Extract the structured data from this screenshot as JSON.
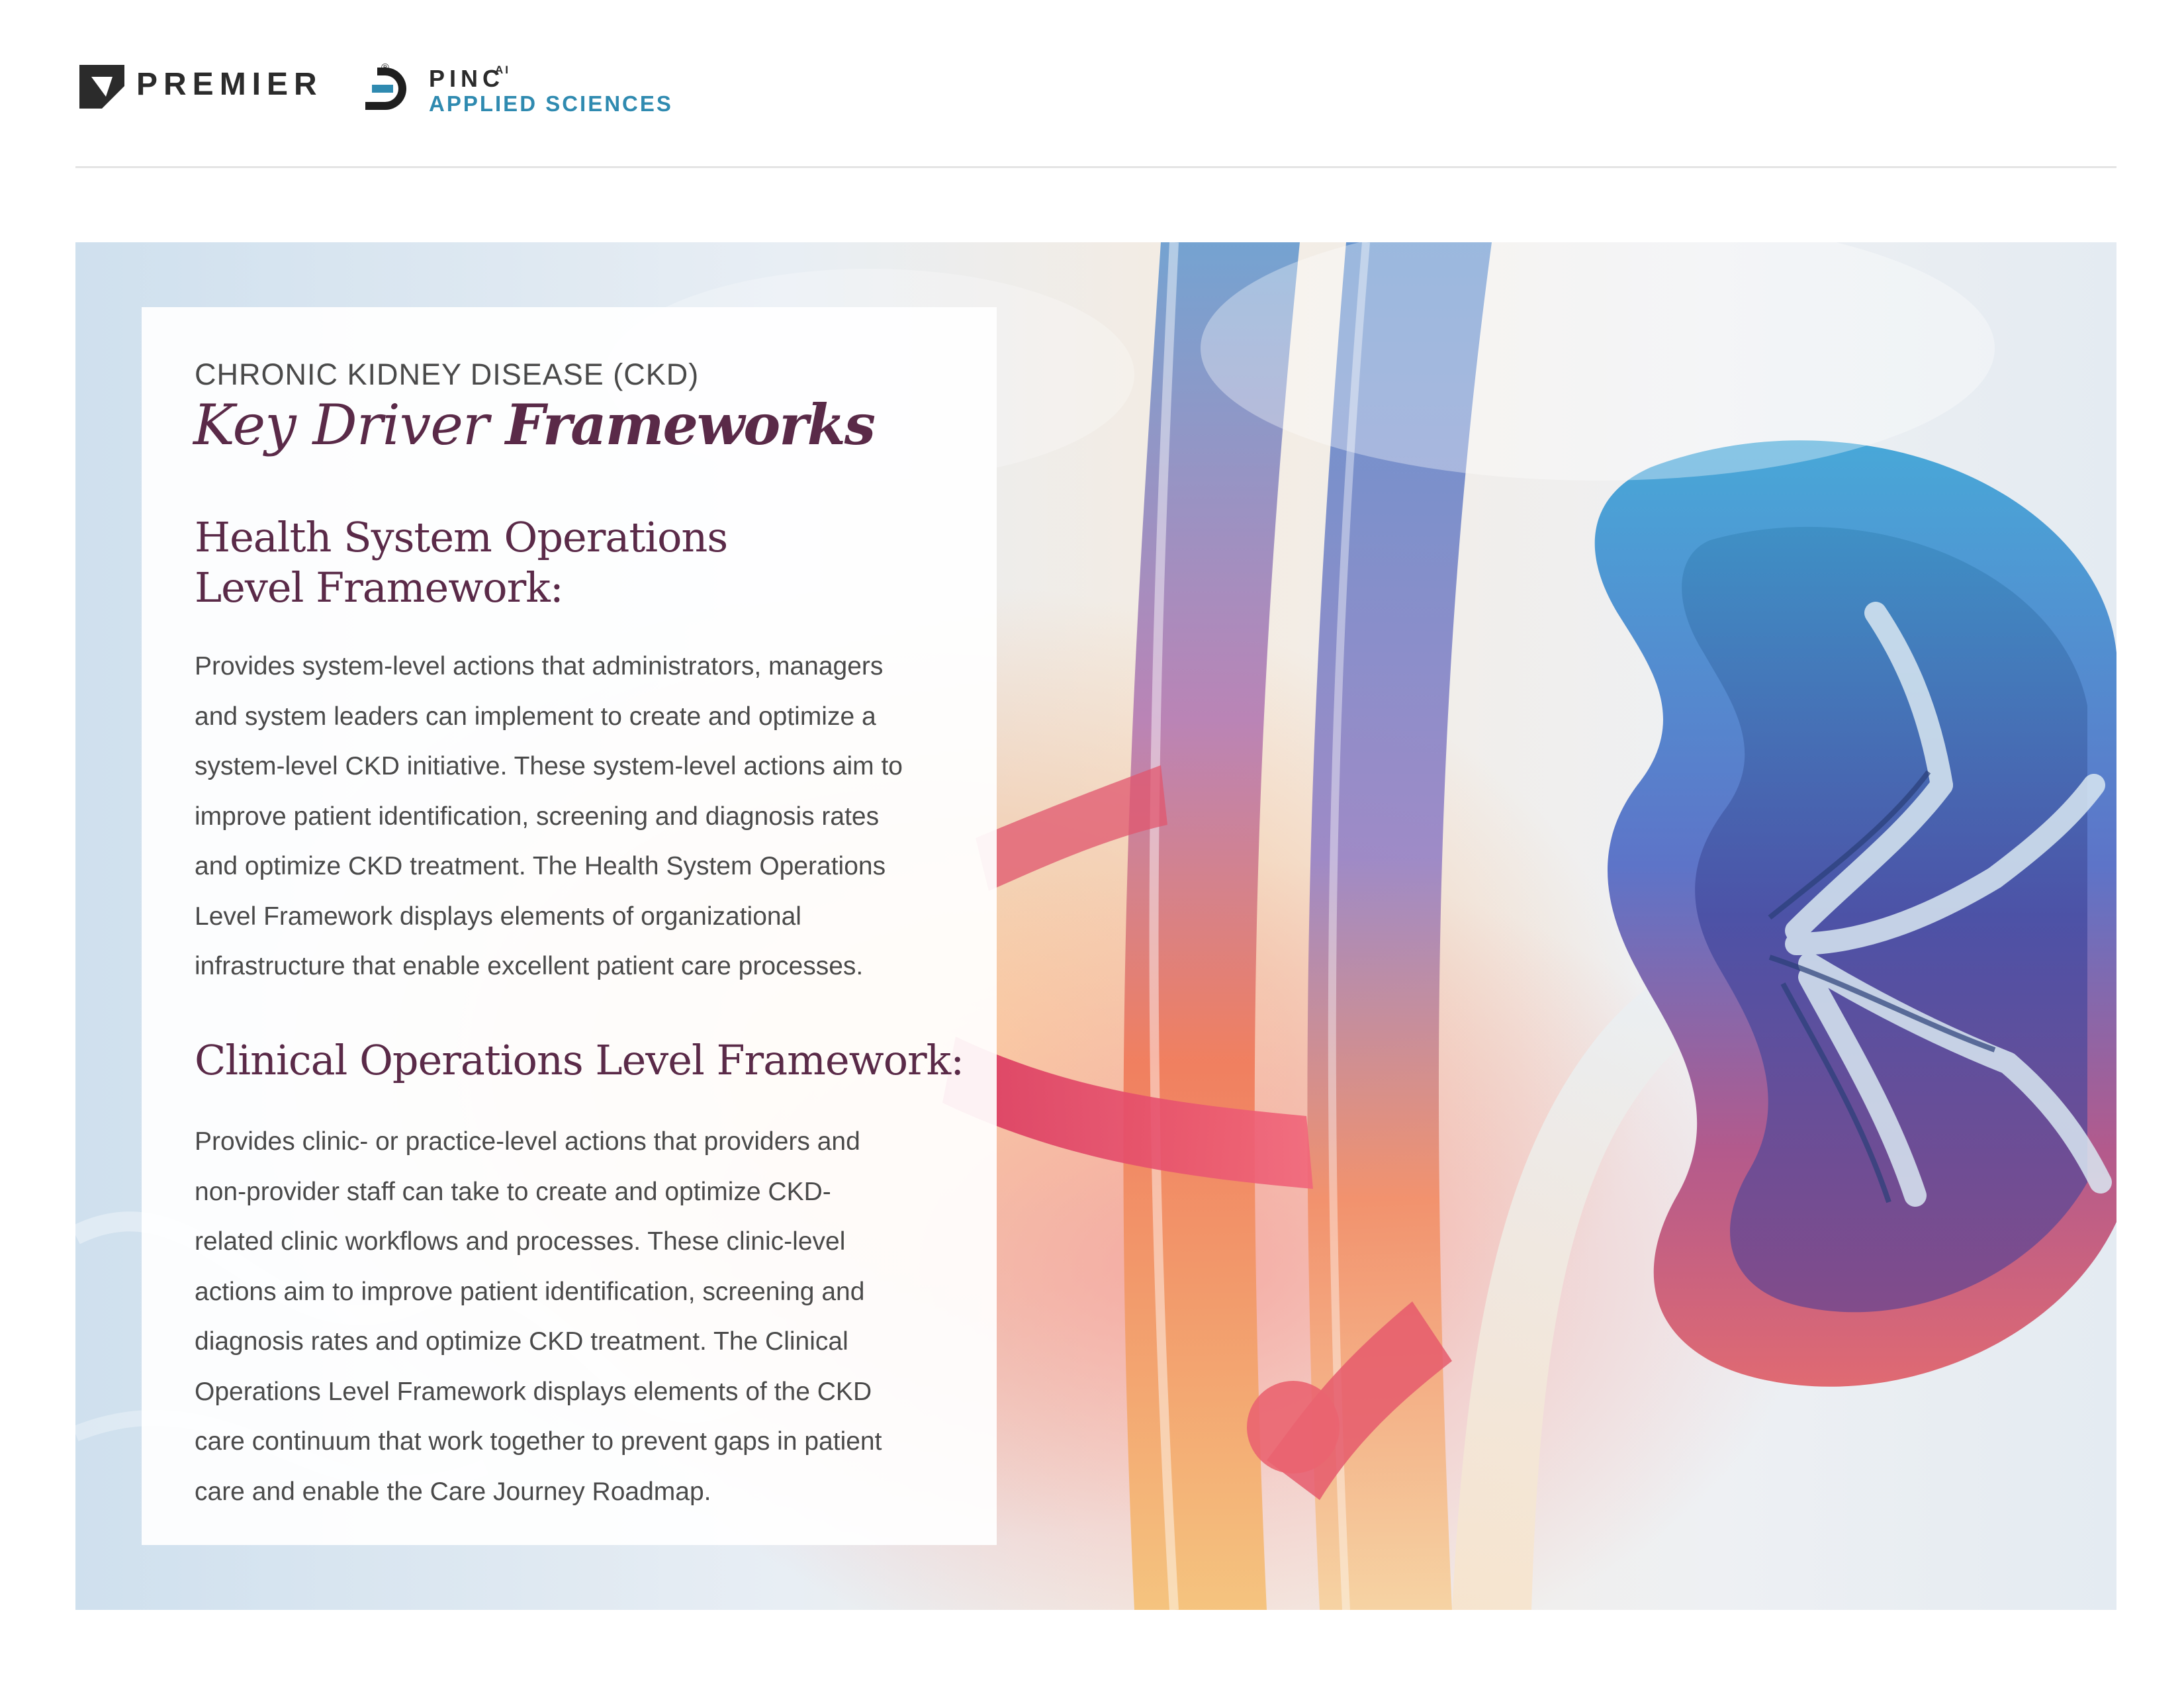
{
  "header": {
    "premier_logo_text": "PREMIER",
    "premier_logo_reg": "®",
    "pinc_logo_text": "PINC",
    "pinc_logo_superscript": "AI",
    "pinc_logo_subtitle": "APPLIED SCIENCES"
  },
  "card": {
    "eyebrow": "CHRONIC KIDNEY DISEASE (CKD)",
    "title_light": "Key Driver ",
    "title_bold": "Frameworks",
    "sections": [
      {
        "heading_lines": [
          "Health System Operations",
          "Level Framework:"
        ],
        "body_lines": [
          "Provides system-level actions that administrators, managers",
          "and system leaders can implement to create and optimize a",
          "system-level CKD initiative. These system-level actions aim to",
          "improve patient identification, screening and diagnosis rates",
          "and optimize CKD treatment. The Health System Operations",
          "Level Framework displays elements of organizational",
          "infrastructure that enable excellent patient care processes."
        ]
      },
      {
        "heading_lines": [
          "Clinical Operations Level Framework:"
        ],
        "body_lines": [
          "Provides clinic- or practice-level actions that providers and",
          "non-provider staff can take to create and optimize CKD-",
          "related clinic workflows and processes. These clinic-level",
          "actions aim to improve patient identification, screening and",
          "diagnosis rates and optimize CKD treatment. The Clinical",
          "Operations Level Framework displays elements of the CKD",
          "care continuum that work together to prevent gaps in patient",
          "care and enable the Care Journey Roadmap."
        ]
      }
    ]
  },
  "colors": {
    "title_plum": "#5a2a48",
    "body_gray": "#4a4a4a",
    "pinc_blue": "#2f8ab0"
  },
  "hero_image": {
    "icon": "kidney-illustration"
  }
}
